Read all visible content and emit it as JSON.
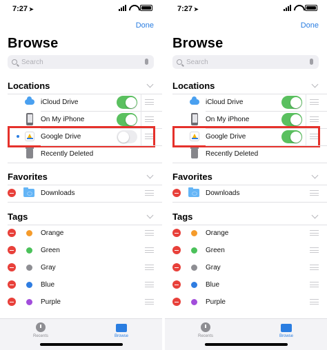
{
  "status": {
    "time": "7:27"
  },
  "nav": {
    "done_label": "Done"
  },
  "page_title": "Browse",
  "search": {
    "placeholder": "Search"
  },
  "sections": {
    "locations": "Locations",
    "favorites": "Favorites",
    "tags": "Tags"
  },
  "locations": [
    {
      "label": "iCloud Drive",
      "icon": "icloud-icon"
    },
    {
      "label": "On My iPhone",
      "icon": "iphone-icon"
    },
    {
      "label": "Google Drive",
      "icon": "google-drive-icon"
    },
    {
      "label": "Recently Deleted",
      "icon": "trash-icon"
    }
  ],
  "favorites": [
    {
      "label": "Downloads",
      "icon": "downloads-folder-icon"
    }
  ],
  "tags": [
    {
      "label": "Orange",
      "color": "#f59b2b"
    },
    {
      "label": "Green",
      "color": "#4bc15a"
    },
    {
      "label": "Gray",
      "color": "#8e8e93"
    },
    {
      "label": "Blue",
      "color": "#2f7de1"
    },
    {
      "label": "Purple",
      "color": "#a24ddb"
    }
  ],
  "toggles": {
    "left": {
      "icloud": true,
      "on_my_iphone": true,
      "google_drive": false
    },
    "right": {
      "icloud": true,
      "on_my_iphone": true,
      "google_drive": true
    }
  },
  "tabbar": {
    "recents": "Recents",
    "browse": "Browse"
  },
  "colors": {
    "accent": "#2a7de1",
    "toggle_on": "#5ac05f",
    "highlight": "#e5312b",
    "delete": "#e8403a"
  }
}
